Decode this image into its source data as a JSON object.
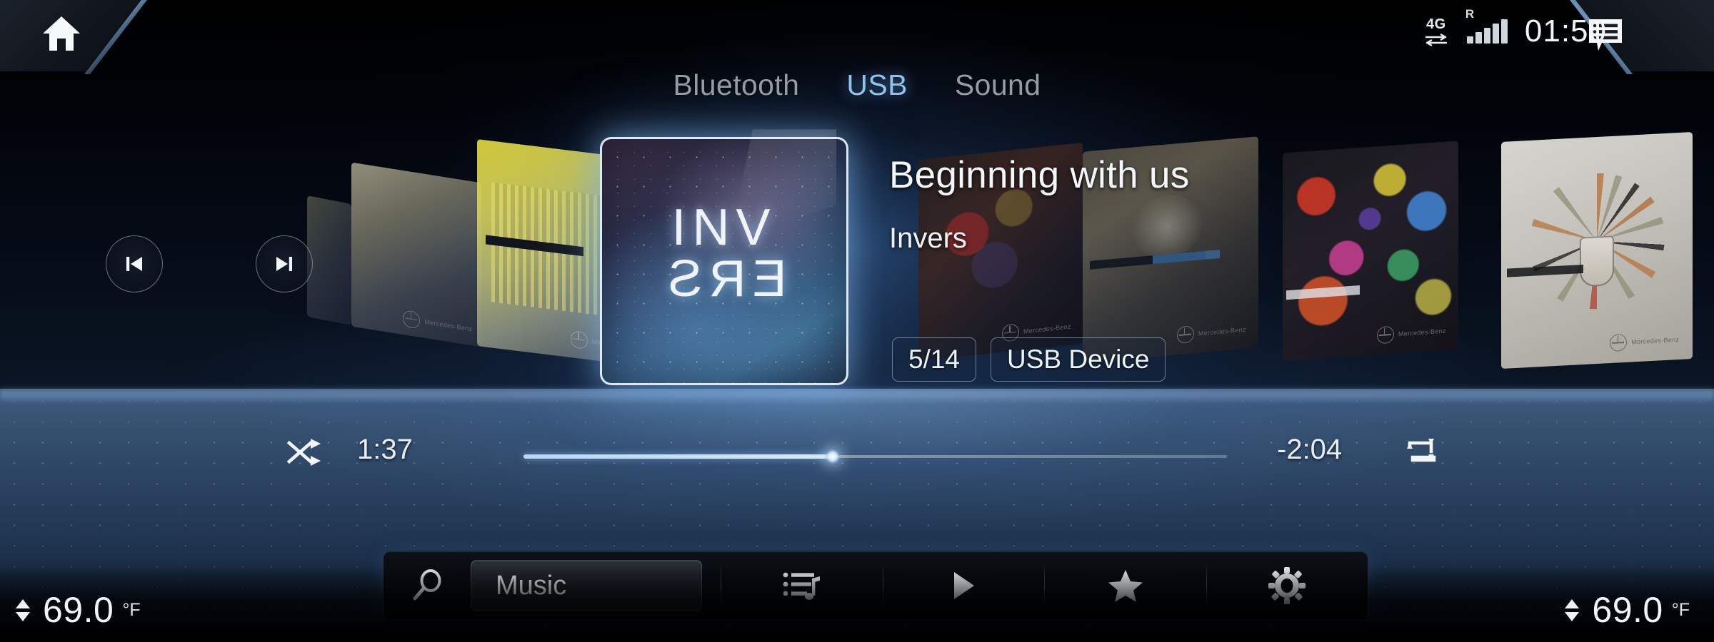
{
  "status_bar": {
    "network_label": "4G",
    "network_icon": "data-transfer-icon",
    "roaming_label": "R",
    "signal_icon": "signal-bars-icon",
    "signal_bars": 5,
    "time": "01:50",
    "messages_icon": "message-list-bubble-icon"
  },
  "home": {
    "icon": "home-icon"
  },
  "tabs": [
    {
      "label": "Bluetooth",
      "active": false
    },
    {
      "label": "USB",
      "active": true
    },
    {
      "label": "Sound",
      "active": false
    }
  ],
  "transport": {
    "previous_icon": "skip-previous-icon",
    "next_icon": "skip-next-icon"
  },
  "album_art": {
    "line1": "INV",
    "line2": "ERS",
    "alt": "album-cover-invers"
  },
  "now_playing": {
    "title": "Beginning with us",
    "artist": "Invers",
    "track_position": "5/14",
    "source": "USB Device"
  },
  "playback": {
    "shuffle_icon": "shuffle-icon",
    "elapsed": "1:37",
    "remaining": "-2:04",
    "repeat_icon": "repeat-icon",
    "progress_percent": 44
  },
  "toolbar": {
    "search_icon": "search-icon",
    "music_label": "Music",
    "playlist_icon": "playlist-music-icon",
    "play_icon": "play-icon",
    "favorite_icon": "star-icon",
    "settings_icon": "gear-icon"
  },
  "climate": {
    "driver_temp": "69.0",
    "driver_unit": "°F",
    "passenger_temp": "69.0",
    "passenger_unit": "°F"
  },
  "colors": {
    "accent": "#8fc4f0",
    "inactive_tab": "#969ca5",
    "text": "#f2f5f8",
    "progress_fill": "#cfe6ff"
  }
}
